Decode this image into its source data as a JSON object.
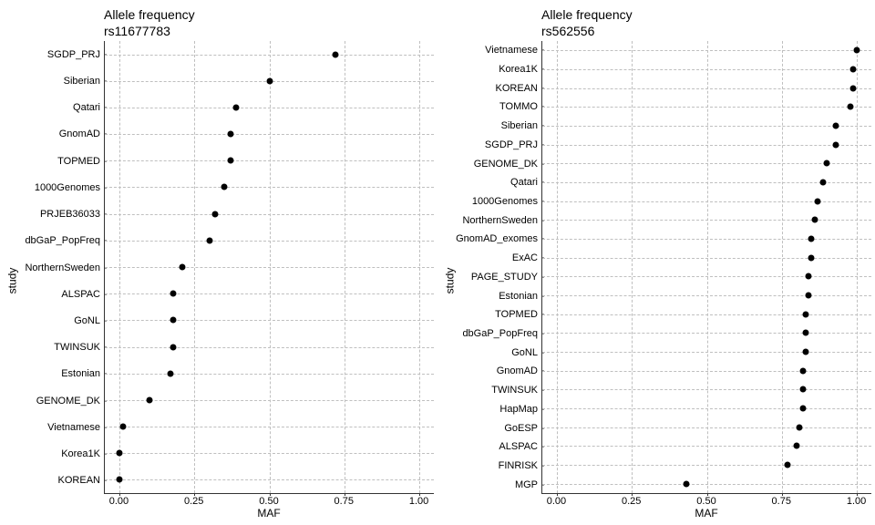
{
  "chart_data": [
    {
      "type": "scatter",
      "title": "Allele frequency",
      "subtitle": "rs11677783",
      "xlabel": "MAF",
      "ylabel": "study",
      "xlim": [
        -0.05,
        1.05
      ],
      "xticks": [
        0.0,
        0.25,
        0.5,
        0.75,
        1.0
      ],
      "xtick_labels": [
        "0.00",
        "0.25",
        "0.50",
        "0.75",
        "1.00"
      ],
      "points": [
        {
          "study": "SGDP_PRJ",
          "maf": 0.72
        },
        {
          "study": "Siberian",
          "maf": 0.5
        },
        {
          "study": "Qatari",
          "maf": 0.39
        },
        {
          "study": "GnomAD",
          "maf": 0.37
        },
        {
          "study": "TOPMED",
          "maf": 0.37
        },
        {
          "study": "1000Genomes",
          "maf": 0.35
        },
        {
          "study": "PRJEB36033",
          "maf": 0.32
        },
        {
          "study": "dbGaP_PopFreq",
          "maf": 0.3
        },
        {
          "study": "NorthernSweden",
          "maf": 0.21
        },
        {
          "study": "ALSPAC",
          "maf": 0.18
        },
        {
          "study": "GoNL",
          "maf": 0.18
        },
        {
          "study": "TWINSUK",
          "maf": 0.18
        },
        {
          "study": "Estonian",
          "maf": 0.17
        },
        {
          "study": "GENOME_DK",
          "maf": 0.1
        },
        {
          "study": "Vietnamese",
          "maf": 0.01
        },
        {
          "study": "Korea1K",
          "maf": 0.0
        },
        {
          "study": "KOREAN",
          "maf": 0.0
        }
      ]
    },
    {
      "type": "scatter",
      "title": "Allele frequency",
      "subtitle": "rs562556",
      "xlabel": "MAF",
      "ylabel": "study",
      "xlim": [
        -0.05,
        1.05
      ],
      "xticks": [
        0.0,
        0.25,
        0.5,
        0.75,
        1.0
      ],
      "xtick_labels": [
        "0.00",
        "0.25",
        "0.50",
        "0.75",
        "1.00"
      ],
      "points": [
        {
          "study": "Vietnamese",
          "maf": 1.0
        },
        {
          "study": "Korea1K",
          "maf": 0.99
        },
        {
          "study": "KOREAN",
          "maf": 0.99
        },
        {
          "study": "TOMMO",
          "maf": 0.98
        },
        {
          "study": "Siberian",
          "maf": 0.93
        },
        {
          "study": "SGDP_PRJ",
          "maf": 0.93
        },
        {
          "study": "GENOME_DK",
          "maf": 0.9
        },
        {
          "study": "Qatari",
          "maf": 0.89
        },
        {
          "study": "1000Genomes",
          "maf": 0.87
        },
        {
          "study": "NorthernSweden",
          "maf": 0.86
        },
        {
          "study": "GnomAD_exomes",
          "maf": 0.85
        },
        {
          "study": "ExAC",
          "maf": 0.85
        },
        {
          "study": "PAGE_STUDY",
          "maf": 0.84
        },
        {
          "study": "Estonian",
          "maf": 0.84
        },
        {
          "study": "TOPMED",
          "maf": 0.83
        },
        {
          "study": "dbGaP_PopFreq",
          "maf": 0.83
        },
        {
          "study": "GoNL",
          "maf": 0.83
        },
        {
          "study": "GnomAD",
          "maf": 0.82
        },
        {
          "study": "TWINSUK",
          "maf": 0.82
        },
        {
          "study": "HapMap",
          "maf": 0.82
        },
        {
          "study": "GoESP",
          "maf": 0.81
        },
        {
          "study": "ALSPAC",
          "maf": 0.8
        },
        {
          "study": "FINRISK",
          "maf": 0.77
        },
        {
          "study": "MGP",
          "maf": 0.43
        }
      ]
    }
  ]
}
